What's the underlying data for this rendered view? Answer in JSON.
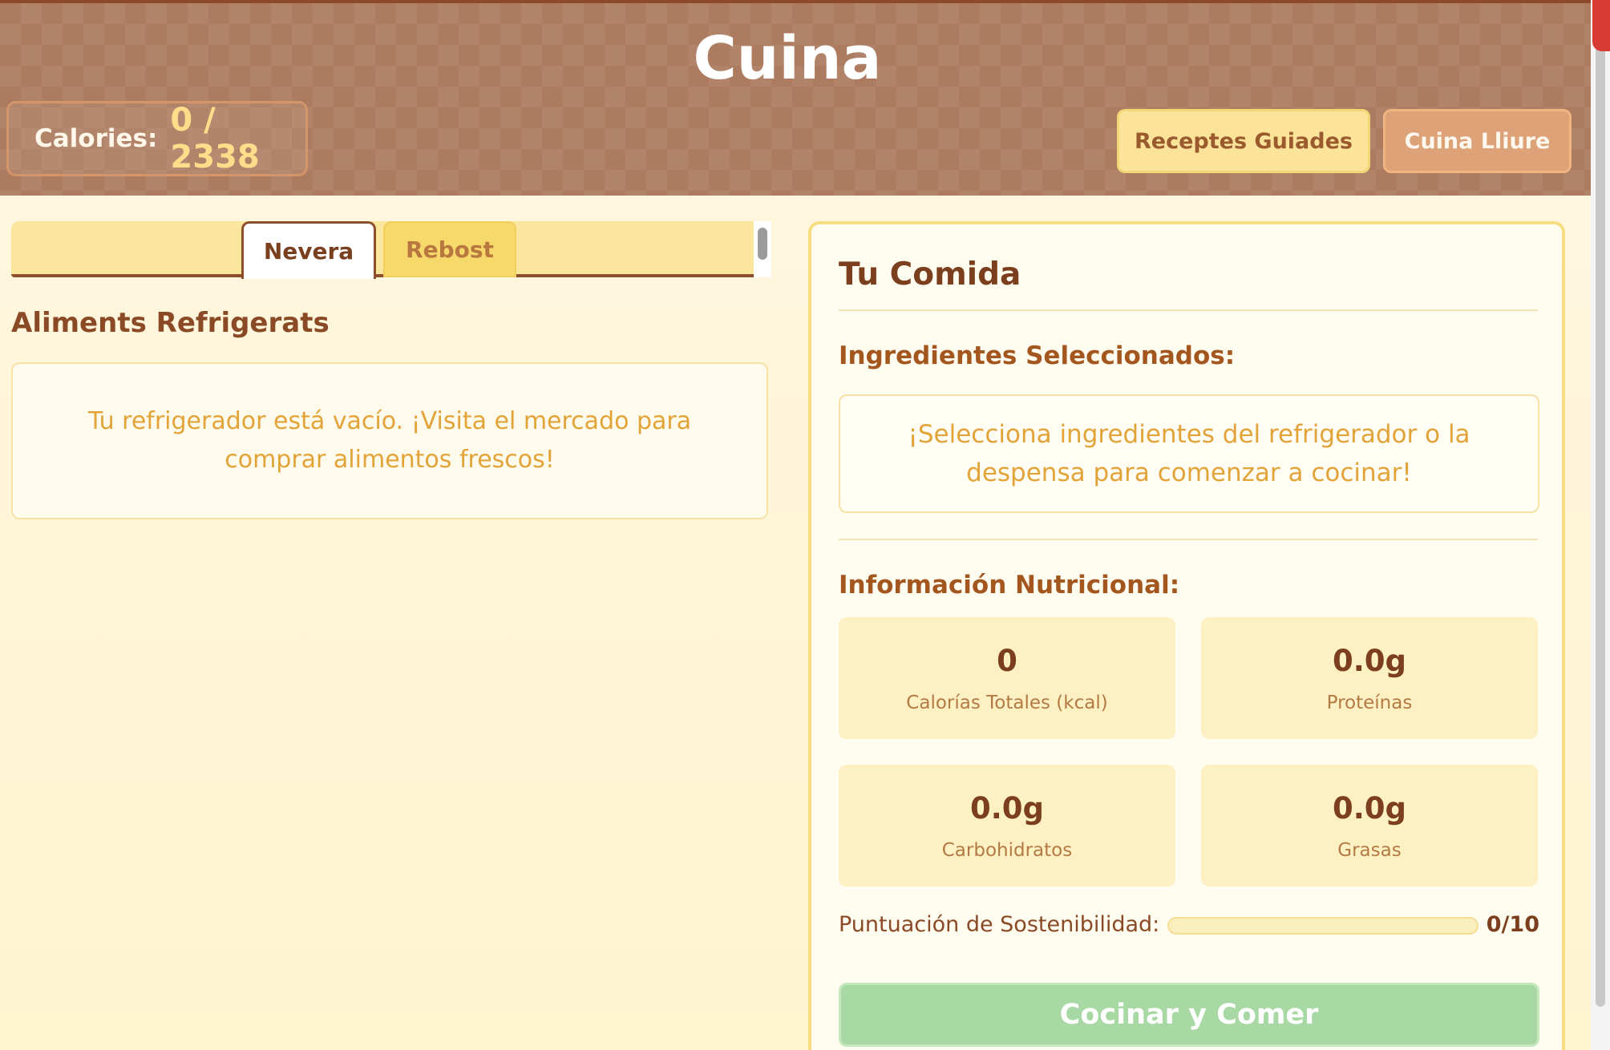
{
  "header": {
    "title": "Cuina",
    "calories_label": "Calories:",
    "calories_value": "0 / 2338",
    "guided_recipes_label": "Receptes Guiades",
    "free_cooking_label": "Cuina Lliure"
  },
  "tabs": {
    "fridge_label": "Nevera",
    "pantry_label": "Rebost",
    "active": "Nevera"
  },
  "fridge": {
    "heading": "Aliments Refrigerats",
    "empty_message": "Tu refrigerador está vacío. ¡Visita el mercado para comprar alimentos frescos!"
  },
  "meal": {
    "title": "Tu Comida",
    "ingredients_label": "Ingredientes Seleccionados:",
    "ingredients_empty": "¡Selecciona ingredientes del refrigerador o la despensa para comenzar a cocinar!",
    "nutrition_label": "Información Nutricional:",
    "nutrition": {
      "calories": {
        "value": "0",
        "caption": "Calorías Totales (kcal)"
      },
      "protein": {
        "value": "0.0g",
        "caption": "Proteínas"
      },
      "carbs": {
        "value": "0.0g",
        "caption": "Carbohidratos"
      },
      "fat": {
        "value": "0.0g",
        "caption": "Grasas"
      }
    },
    "sustainability_label": "Puntuación de Sostenibilidad:",
    "sustainability_value": "0/10",
    "sustainability_fraction": 0,
    "cook_button_label": "Cocinar y Comer"
  },
  "colors": {
    "header_bg": "#ad7c60",
    "accent_brown": "#7c3f1e",
    "empty_text": "#e2a338",
    "cook_button": "#a8d9a4"
  }
}
